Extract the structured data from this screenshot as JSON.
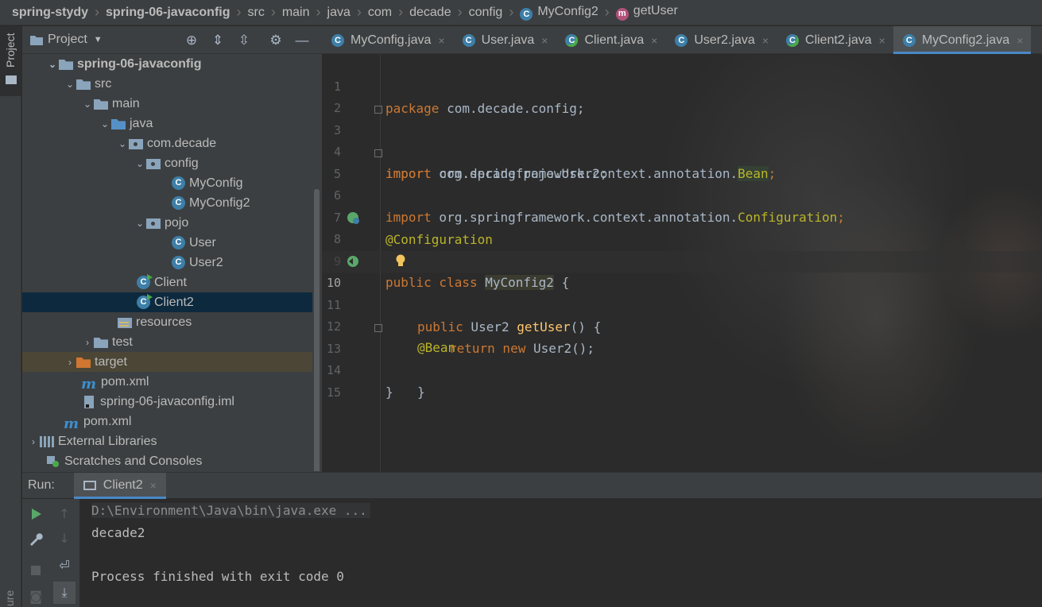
{
  "breadcrumb": {
    "items": [
      "spring-stydy",
      "spring-06-javaconfig",
      "src",
      "main",
      "java",
      "com",
      "decade",
      "config",
      "MyConfig2",
      "getUser"
    ],
    "class_badge": "C",
    "method_badge": "m"
  },
  "left_strip": {
    "project_tab": "Project",
    "bottom_tab": "ure"
  },
  "project_panel": {
    "title": "Project",
    "tree": [
      {
        "label": "spring-06-javaconfig",
        "icon": "module-folder-icon"
      },
      {
        "label": "src",
        "icon": "folder-icon"
      },
      {
        "label": "main",
        "icon": "folder-icon"
      },
      {
        "label": "java",
        "icon": "source-folder-icon"
      },
      {
        "label": "com.decade",
        "icon": "package-icon"
      },
      {
        "label": "config",
        "icon": "package-icon"
      },
      {
        "label": "MyConfig",
        "icon": "class-icon"
      },
      {
        "label": "MyConfig2",
        "icon": "class-icon"
      },
      {
        "label": "pojo",
        "icon": "package-icon"
      },
      {
        "label": "User",
        "icon": "class-icon"
      },
      {
        "label": "User2",
        "icon": "class-icon"
      },
      {
        "label": "Client",
        "icon": "runnable-class-icon"
      },
      {
        "label": "Client2",
        "icon": "runnable-class-icon"
      },
      {
        "label": "resources",
        "icon": "resources-folder-icon"
      },
      {
        "label": "test",
        "icon": "folder-icon"
      },
      {
        "label": "target",
        "icon": "excluded-folder-icon"
      },
      {
        "label": "pom.xml",
        "icon": "maven-icon"
      },
      {
        "label": "spring-06-javaconfig.iml",
        "icon": "iml-file-icon"
      },
      {
        "label": "pom.xml",
        "icon": "maven-icon"
      },
      {
        "label": "External Libraries",
        "icon": "libraries-icon"
      },
      {
        "label": "Scratches and Consoles",
        "icon": "scratches-icon"
      }
    ]
  },
  "editor": {
    "tabs": [
      {
        "label": "MyConfig.java",
        "close": "×"
      },
      {
        "label": "User.java",
        "close": "×"
      },
      {
        "label": "Client.java",
        "close": "×"
      },
      {
        "label": "User2.java",
        "close": "×"
      },
      {
        "label": "Client2.java",
        "close": "×"
      },
      {
        "label": "MyConfig2.java",
        "close": "×"
      }
    ],
    "active_tab": "MyConfig2.java",
    "line_numbers": [
      "1",
      "2",
      "3",
      "4",
      "5",
      "6",
      "7",
      "8",
      "9",
      "10",
      "11",
      "12",
      "13",
      "14",
      "15"
    ],
    "code": {
      "l1_kw": "package",
      "l1_rest": " com.decade.config;",
      "l3_kw": "import",
      "l3_rest": " com.decade.pojo.User2;",
      "l4_kw": "import",
      "l4_rest": " org.springframework.context.annotation.",
      "l4_hl": "Bean",
      "l4_end": ";",
      "l5_kw": "import",
      "l5_rest": " org.springframework.context.annotation.",
      "l5_ann": "Configuration",
      "l5_end": ";",
      "l7_ann": "@Configuration",
      "l8_kw": "public class",
      "l8_sp": " ",
      "l8_class": "MyConfig2",
      "l8_end": " {",
      "l10_ann": "@Bean",
      "l11_kw": "public",
      "l11_type": " User2 ",
      "l11_method": "getUser",
      "l11_end": "() {",
      "l12_kw": "return new",
      "l12_rest": " User2();",
      "l13": "}",
      "l14": "}"
    }
  },
  "run_panel": {
    "label": "Run:",
    "tab": "Client2",
    "tab_close": "×",
    "console": {
      "command": "D:\\Environment\\Java\\bin\\java.exe ...",
      "output": "decade2",
      "exit": "Process finished with exit code 0"
    }
  },
  "colors": {
    "keyword": "#cc7832",
    "annotation": "#bbb529",
    "method": "#ffc66d",
    "accent": "#4a88c7",
    "run_green": "#59a869"
  }
}
